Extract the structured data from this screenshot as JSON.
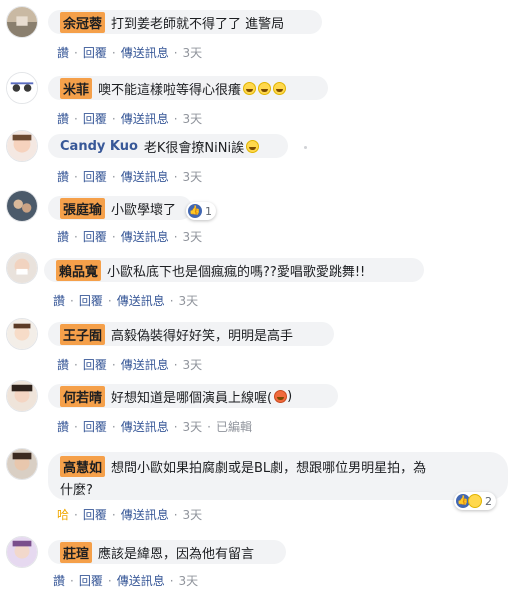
{
  "actions": {
    "like": "讚",
    "like_alt": "哈",
    "reply": "回覆",
    "message": "傳送訊息",
    "time": "3天",
    "edited": "已編輯"
  },
  "comments": [
    {
      "name": "余冠蓉",
      "text": "打到姜老師就不得了了 進警局",
      "emojis": 0
    },
    {
      "name": "米菲",
      "text": "噢不能這樣啦等得心很癢",
      "emojis": 3
    },
    {
      "name": "Candy Kuo",
      "text": "老K很會撩NiNi誒",
      "emojis": 1
    },
    {
      "name": "張庭瑜",
      "text": "小歐學壞了",
      "emojis": 0,
      "reaction_count": "1"
    },
    {
      "name": "賴品寬",
      "text": "小歐私底下也是個瘋瘋的嗎??愛唱歌愛跳舞!!",
      "emojis": 0
    },
    {
      "name": "王子囿",
      "text": "高毅偽裝得好好笑，明明是高手",
      "emojis": 0
    },
    {
      "name": "何若晴",
      "text": "好想知道是哪個演員上線喔(",
      "text_after": ")",
      "emojis": 0,
      "angry_emoji": true
    },
    {
      "name": "高慧如",
      "text": "想問小歐如果拍腐劇或是BL劇，想跟哪位男明星拍，為",
      "text2": "什麼?",
      "emojis": 0,
      "reaction_count": "2"
    },
    {
      "name": "莊瑄",
      "text": "應該是緯恩，因為他有留言",
      "emojis": 0
    }
  ],
  "colors": {
    "bubble": "#f2f3f5",
    "name_highlight": "#f5a04a",
    "link": "#385898",
    "meta": "#90949c",
    "like_blue": "#4267b2"
  }
}
